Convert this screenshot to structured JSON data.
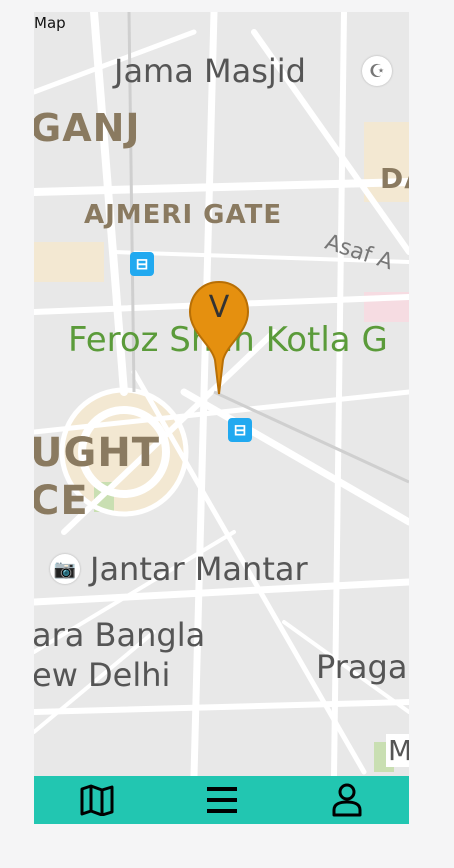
{
  "header": {
    "title": "Map"
  },
  "map": {
    "labels": {
      "jama_masjid": "Jama Masjid",
      "ganj": "GANJ",
      "da": "DA",
      "ajmeri_gate": "AJMERI GATE",
      "asaf": "Asaf A",
      "feroz": "Feroz Shah Kotla G",
      "connaught_1": "UGHT",
      "connaught_2": "CE",
      "jantar": "Jantar Mantar",
      "bangla_1": "ara Bangla",
      "bangla_2": "ew Delhi",
      "pragati": "Praga",
      "m": "M"
    },
    "marker": {
      "letter": "V",
      "color": "#e5900f"
    }
  },
  "bottom_nav": {
    "background": "#22c6b1",
    "items": [
      {
        "name": "map-icon"
      },
      {
        "name": "menu-icon"
      },
      {
        "name": "profile-icon"
      }
    ]
  }
}
